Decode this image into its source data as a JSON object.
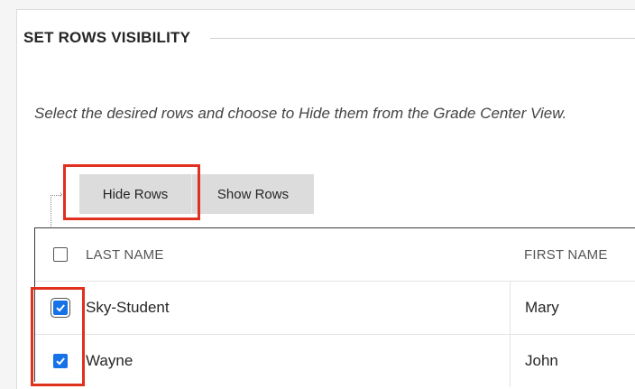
{
  "section": {
    "title": "SET ROWS VISIBILITY"
  },
  "instructions": "Select the desired rows and choose to Hide them from the Grade Center View.",
  "toolbar": {
    "hide_label": "Hide Rows",
    "show_label": "Show Rows"
  },
  "table": {
    "columns": [
      "LAST NAME",
      "FIRST NAME"
    ],
    "select_all_checked": false,
    "rows": [
      {
        "last": "Sky-Student",
        "first": "Mary",
        "checked": true
      },
      {
        "last": "Wayne",
        "first": "John",
        "checked": true
      }
    ]
  },
  "colors": {
    "accent": "#1672e6",
    "highlight": "#e0301e"
  }
}
